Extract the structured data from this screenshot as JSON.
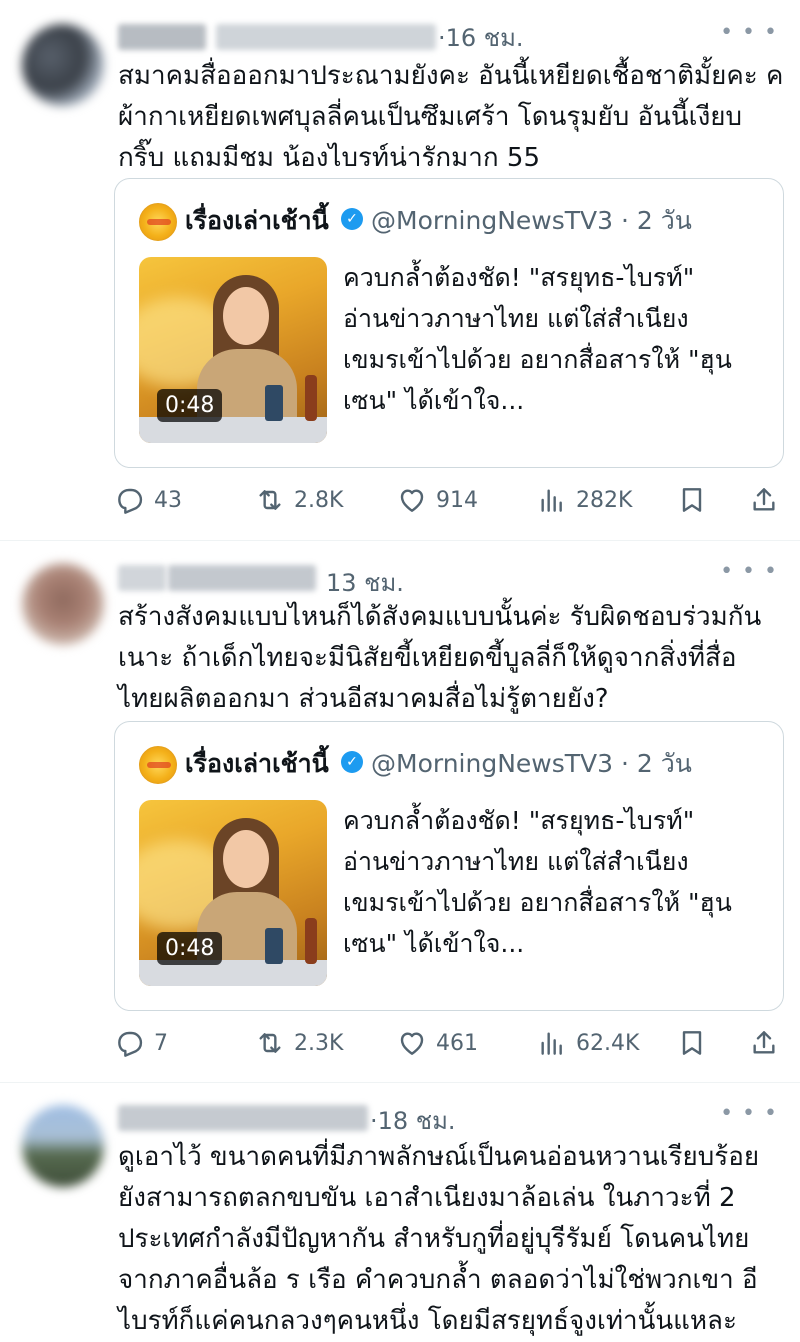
{
  "tweets": [
    {
      "time": "·16 ชม.",
      "text": "สมาคมสื่อออกมาประณามยังคะ อันนี้เหยียดเชื้อชาติมั้ยคะ ค\nผ้ากาเหยียดเพศบุลลี่คนเป็นซึมเศร้า โดนรุมยับ อันนี้เงียบ\nกริ๊บ แถมมีชม น้องไบรท์น่ารักมาก 55",
      "quote": {
        "name": "เรื่องเล่าเช้านี้",
        "handle": "@MorningNewsTV3 · 2 วัน",
        "duration": "0:48",
        "text": "ควบกล้ำต้องชัด! \"สรยุทธ-ไบรท์\"\nอ่านข่าวภาษาไทย แต่ใส่สำเนียง\nเขมรเข้าไปด้วย อยากสื่อสารให้ \"ฮุน\nเซน\" ได้เข้าใจ..."
      },
      "stats": {
        "replies": "43",
        "retweets": "2.8K",
        "likes": "914",
        "views": "282K"
      }
    },
    {
      "time": "13 ชม.",
      "text": "สร้างสังคมแบบไหนก็ได้สังคมแบบนั้นค่ะ รับผิดชอบร่วมกัน\nเนาะ ถ้าเด็กไทยจะมีนิสัยขี้เหยียดขี้บูลลี่ก็ให้ดูจากสิ่งที่สื่อ\nไทยผลิตออกมา ส่วนอีสมาคมสื่อไม่รู้ตายยัง?",
      "quote": {
        "name": "เรื่องเล่าเช้านี้",
        "handle": "@MorningNewsTV3 · 2 วัน",
        "duration": "0:48",
        "text": "ควบกล้ำต้องชัด! \"สรยุทธ-ไบรท์\"\nอ่านข่าวภาษาไทย แต่ใส่สำเนียง\nเขมรเข้าไปด้วย อยากสื่อสารให้ \"ฮุน\nเซน\" ได้เข้าใจ..."
      },
      "stats": {
        "replies": "7",
        "retweets": "2.3K",
        "likes": "461",
        "views": "62.4K"
      }
    },
    {
      "time": "·18 ชม.",
      "text": "ดูเอาไว้ ขนาดคนที่มีภาพลักษณ์เป็นคนอ่อนหวานเรียบร้อย\nยังสามารถตลกขบขัน เอาสำเนียงมาล้อเล่น ในภาวะที่ 2\nประเทศกำลังมีปัญหากัน สำหรับกูที่อยู่บุรีรัมย์ โดนคนไทย\nจากภาคอื่นล้อ ร เรือ คำควบกล้ำ ตลอดว่าไม่ใช่พวกเขา อี\nไบรท์ก็แค่คนกลวงๆคนหนึ่ง โดยมีสรยุทธ์จูงเท่านั้นแหละ"
    }
  ],
  "icons": {
    "more": "more-icon",
    "verified": "verified-badge-icon",
    "reply": "reply-icon",
    "retweet": "retweet-icon",
    "like": "heart-icon",
    "views": "views-icon",
    "bookmark": "bookmark-icon",
    "share": "share-icon"
  },
  "colors": {
    "text": "#0f1419",
    "secondary": "#536471",
    "verified": "#1d9bf0",
    "border": "#cfd9de"
  }
}
